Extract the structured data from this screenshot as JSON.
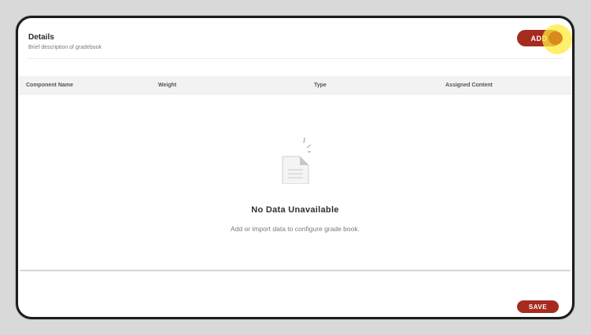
{
  "details": {
    "title": "Details",
    "subtitle": "Brief description of gradebook"
  },
  "actions": {
    "add_label": "ADD",
    "save_label": "SAVE"
  },
  "table": {
    "columns": [
      "Component Name",
      "Weight",
      "Type",
      "Assigned Content"
    ]
  },
  "empty_state": {
    "icon": "document-icon",
    "title": "No Data Unavailable",
    "description": "Add or import data to configure grade book."
  },
  "colors": {
    "accent": "#a62b1f",
    "highlight": "#ffeb3b"
  }
}
